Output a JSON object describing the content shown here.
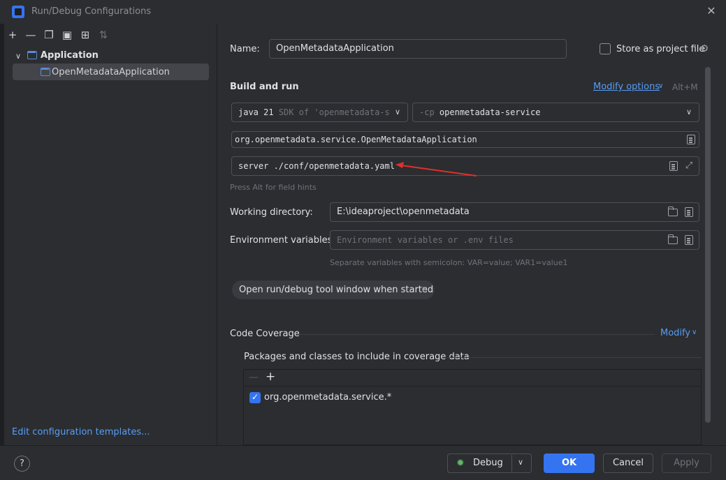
{
  "window": {
    "title": "Run/Debug Configurations"
  },
  "sidebar": {
    "tree": [
      {
        "label": "Application"
      },
      {
        "label": "OpenMetadataApplication"
      }
    ],
    "edit_templates_link": "Edit configuration templates..."
  },
  "form": {
    "name_label": "Name:",
    "name_value": "OpenMetadataApplication",
    "store_as_project_label": "Store as project file",
    "build_and_run_title": "Build and run",
    "modify_options_label": "Modify options",
    "modify_options_shortcut": "Alt+M",
    "sdk_java": "java 21",
    "sdk_suffix": "SDK of 'openmetadata-s",
    "classpath_prefix": "-cp",
    "classpath_module": "openmetadata-service",
    "main_class": "org.openmetadata.service.OpenMetadataApplication",
    "program_args": "server ./conf/openmetadata.yaml",
    "field_hints": "Press Alt for field hints",
    "working_dir_label": "Working directory:",
    "working_dir_value": "E:\\ideaproject\\openmetadata",
    "env_vars_label": "Environment variables:",
    "env_vars_placeholder": "Environment variables or .env files",
    "env_vars_hint": "Separate variables with semicolon: VAR=value; VAR1=value1",
    "open_tool_window_chip": "Open run/debug tool window when started",
    "code_coverage_title": "Code Coverage",
    "modify_label": "Modify",
    "packages_title": "Packages and classes to include in coverage data",
    "coverage_items": [
      {
        "label": "org.openmetadata.service.*",
        "checked": true
      }
    ]
  },
  "footer": {
    "help": "?",
    "debug": "Debug",
    "ok": "OK",
    "cancel": "Cancel",
    "apply": "Apply"
  },
  "colors": {
    "accent": "#3574f0",
    "annotation_arrow": "#e0302b"
  }
}
